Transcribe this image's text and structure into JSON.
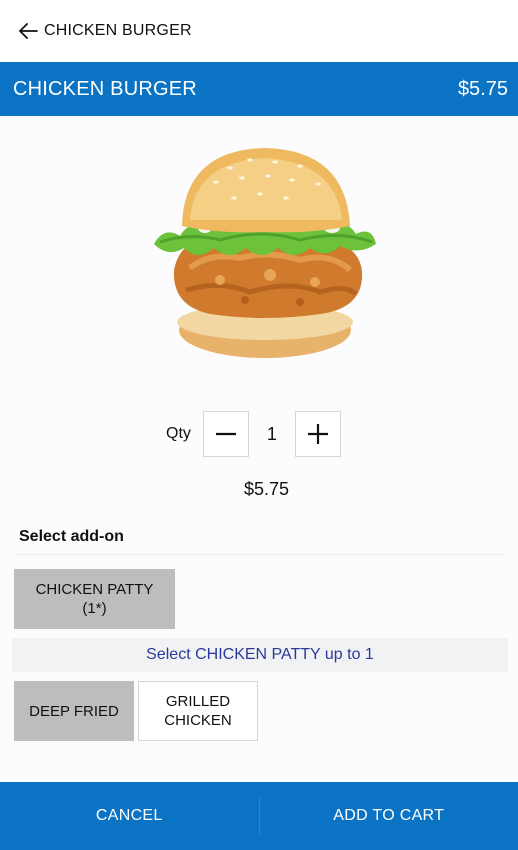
{
  "topbar": {
    "title": "CHICKEN BURGER",
    "back_icon": "arrow-left-icon"
  },
  "product": {
    "name": "CHICKEN BURGER",
    "price": "$5.75",
    "image": "chicken-burger-image"
  },
  "quantity": {
    "label": "Qty",
    "value": "1",
    "decrement_icon": "minus-icon",
    "increment_icon": "plus-icon"
  },
  "total_price": "$5.75",
  "addon": {
    "title": "Select add-on",
    "category_label": "CHICKEN PATTY\n(1*)",
    "hint": "Select CHICKEN PATTY up to 1",
    "options": [
      {
        "label": "DEEP FRIED",
        "selected": true
      },
      {
        "label": "GRILLED\nCHICKEN",
        "selected": false
      }
    ]
  },
  "actions": {
    "cancel": "CANCEL",
    "add_to_cart": "ADD TO CART"
  },
  "colors": {
    "brand_blue": "#0a73c4",
    "selected_grey": "#bdbdbd",
    "hint_text": "#2a3a9a"
  }
}
